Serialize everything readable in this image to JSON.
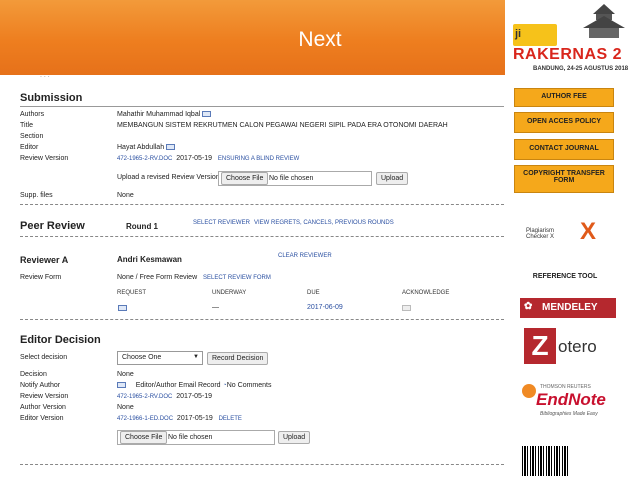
{
  "slide": {
    "title": "Next"
  },
  "logo": {
    "ji": "ji",
    "rakernas": "RAKERNAS 2",
    "date": "BANDUNG, 24-25 AGUSTUS 2018"
  },
  "submission": {
    "heading": "Submission",
    "authors_label": "Authors",
    "authors": "Mahathir Muhammad Iqbal",
    "title_label": "Title",
    "title": "MEMBANGUN SISTEM REKRUTMEN CALON PEGAWAI NEGERI SIPIL PADA ERA OTONOMI DAERAH",
    "section_label": "Section",
    "editor_label": "Editor",
    "editor": "Hayat Abdullah",
    "review_version_label": "Review Version",
    "review_file": "472-1965-2-RV.DOC",
    "review_date": "2017-05-19",
    "blind_review_link": "ENSURING A BLIND REVIEW",
    "upload_label": "Upload a revised Review Version",
    "choose_file": "Choose File",
    "no_file": "No file chosen",
    "upload_button": "Upload",
    "supp_label": "Supp. files",
    "supp_value": "None"
  },
  "peer_review": {
    "heading": "Peer Review",
    "round": "Round 1",
    "select_reviewer": "SELECT REVIEWER",
    "view_regrets": "VIEW REGRETS, CANCELS, PREVIOUS ROUNDS",
    "reviewer_label": "Reviewer A",
    "reviewer_name": "Andri Kesmawan",
    "clear_reviewer": "CLEAR REVIEWER",
    "review_form_label": "Review Form",
    "review_form": "None / Free Form Review",
    "select_review_form": "SELECT REVIEW FORM",
    "columns": [
      "REQUEST",
      "UNDERWAY",
      "DUE",
      "ACKNOWLEDGE"
    ],
    "underway": "—",
    "due": "2017-06-09"
  },
  "editor_decision": {
    "heading": "Editor Decision",
    "select_label": "Select decision",
    "select_value": "Choose One",
    "record_button": "Record Decision",
    "decision_label": "Decision",
    "decision": "None",
    "notify_label": "Notify Author",
    "notify_text": "Editor/Author Email Record",
    "no_comments": "No Comments",
    "review_version_label": "Review Version",
    "review_file": "472-1965-2-RV.DOC",
    "review_date": "2017-05-19",
    "author_version_label": "Author Version",
    "author_version": "None",
    "editor_version_label": "Editor Version",
    "editor_file": "472-1966-1-ED.DOC",
    "editor_date": "2017-05-19",
    "delete": "DELETE",
    "choose_file": "Choose File",
    "no_file": "No file chosen",
    "upload_button": "Upload"
  },
  "sidebar": {
    "buttons": [
      "AUTHOR FEE",
      "OPEN ACCES POLICY",
      "CONTACT JOURNAL",
      "COPYRIGHT TRANSFER FORM"
    ],
    "plagiarism": "Plagiarism Checker X",
    "reference_tool": "REFERENCE TOOL",
    "mendeley": "MENDELEY",
    "zotero": "otero",
    "endnote_top": "THOMSON REUTERS",
    "endnote": "EndNote",
    "endnote_tag": "Bibliographies Made Easy"
  }
}
